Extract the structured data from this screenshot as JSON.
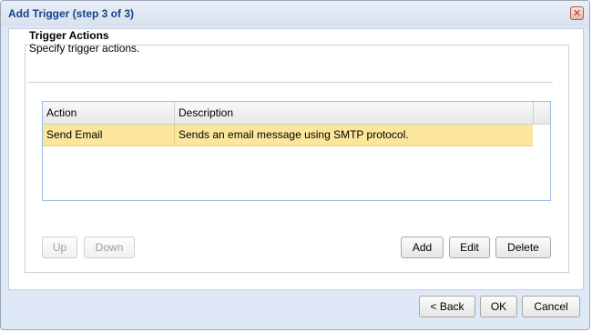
{
  "dialog": {
    "title": "Add Trigger (step 3 of 3)",
    "close_icon": "close-icon"
  },
  "section": {
    "heading": "Trigger Actions",
    "subheading": "Specify trigger actions."
  },
  "grid": {
    "columns": [
      "Action",
      "Description"
    ],
    "rows": [
      {
        "action": "Send Email",
        "description": "Sends an email message using SMTP protocol.",
        "selected": true
      }
    ]
  },
  "buttons": {
    "up": "Up",
    "down": "Down",
    "add": "Add",
    "edit": "Edit",
    "delete": "Delete",
    "back": "< Back",
    "ok": "OK",
    "cancel": "Cancel"
  },
  "colors": {
    "title_text": "#15428b",
    "selected_row": "#fbe69c",
    "dialog_bg": "#dfe8f6"
  }
}
